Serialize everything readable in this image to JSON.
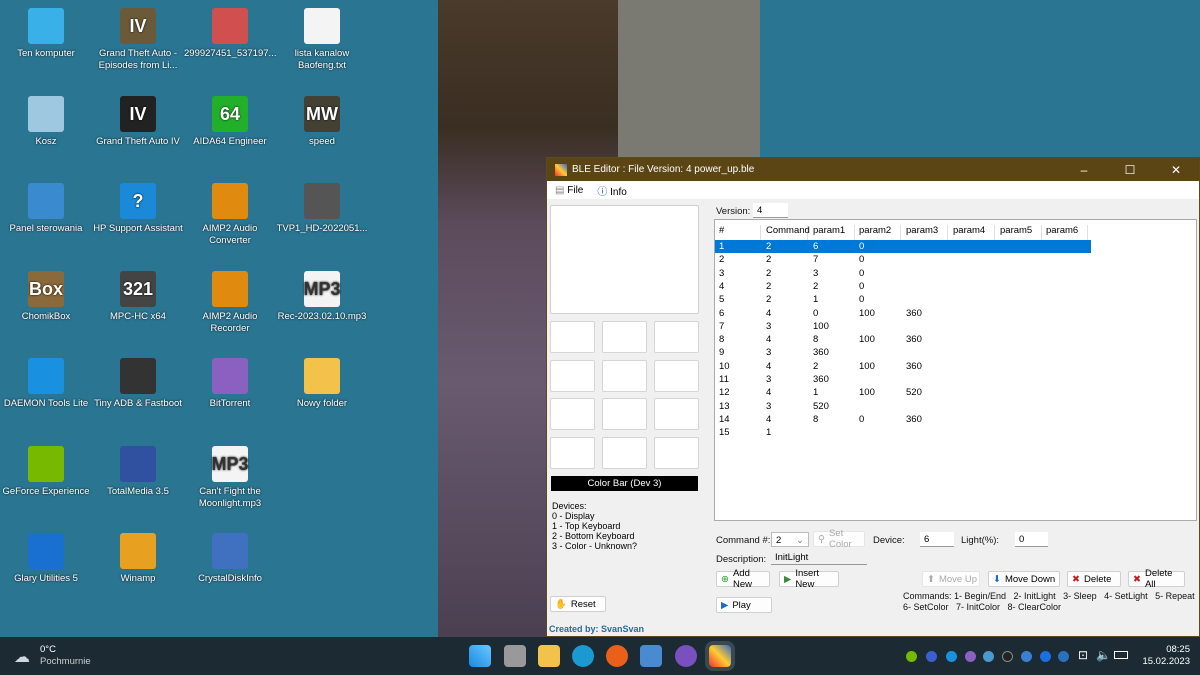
{
  "desktop": {
    "icons": [
      {
        "label": "Ten komputer",
        "color": "#3ab0e8",
        "glyph": "monitor-icon"
      },
      {
        "label": "Grand Theft Auto - Episodes from Li...",
        "color": "#6b5a3a",
        "glyph": "IV"
      },
      {
        "label": "299927451_537197...",
        "color": "#d05050",
        "glyph": "image-icon"
      },
      {
        "label": "lista kanalow Baofeng.txt",
        "color": "#f4f4f4",
        "glyph": "text-file-icon"
      },
      {
        "label": "Kosz",
        "color": "#9ec8e0",
        "glyph": "recycle-bin-icon"
      },
      {
        "label": "Grand Theft Auto IV",
        "color": "#222222",
        "glyph": "IV"
      },
      {
        "label": "AIDA64 Engineer",
        "color": "#22b02a",
        "glyph": "64"
      },
      {
        "label": "speed",
        "color": "#444033",
        "glyph": "MW"
      },
      {
        "label": "Panel sterowania",
        "color": "#3a8ad0",
        "glyph": "control-panel-icon"
      },
      {
        "label": "HP Support Assistant",
        "color": "#1a8ad8",
        "glyph": "?"
      },
      {
        "label": "AIMP2 Audio Converter",
        "color": "#e08a10",
        "glyph": "aimp-icon"
      },
      {
        "label": "TVP1_HD-2022051...",
        "color": "#555555",
        "glyph": "video-icon"
      },
      {
        "label": "ChomikBox",
        "color": "#8a6a3a",
        "glyph": "Box"
      },
      {
        "label": "MPC-HC x64",
        "color": "#444444",
        "glyph": "321"
      },
      {
        "label": "AIMP2 Audio Recorder",
        "color": "#e08a10",
        "glyph": "aimp-icon"
      },
      {
        "label": "Rec-2023.02.10.mp3",
        "color": "#f4f4f4",
        "glyph": "MP3"
      },
      {
        "label": "DAEMON Tools Lite",
        "color": "#1a90e0",
        "glyph": "daemon-icon"
      },
      {
        "label": "Tiny ADB & Fastboot",
        "color": "#333333",
        "glyph": "adb-icon"
      },
      {
        "label": "BitTorrent",
        "color": "#8a60c0",
        "glyph": "bittorrent-icon"
      },
      {
        "label": "Nowy folder",
        "color": "#f2c24a",
        "glyph": "folder-icon"
      },
      {
        "label": "GeForce Experience",
        "color": "#76b900",
        "glyph": "nvidia-icon"
      },
      {
        "label": "TotalMedia 3.5",
        "color": "#3050a0",
        "glyph": "totalmedia-icon"
      },
      {
        "label": "Can't Fight the Moonlight.mp3",
        "color": "#f4f4f4",
        "glyph": "MP3"
      },
      {
        "label": "",
        "color": "",
        "glyph": ""
      },
      {
        "label": "Glary Utilities 5",
        "color": "#1a70d0",
        "glyph": "glary-icon"
      },
      {
        "label": "Winamp",
        "color": "#e8a020",
        "glyph": "winamp-icon"
      },
      {
        "label": "CrystalDiskInfo",
        "color": "#4070c0",
        "glyph": "crystaldisk-icon"
      }
    ]
  },
  "window": {
    "title": "BLE Editor : File Version: 4  power_up.ble",
    "minimize": "–",
    "maximize": "☐",
    "close": "✕",
    "menu": {
      "file": "File",
      "info": "Info"
    },
    "version_label": "Version:",
    "version_value": "4",
    "color_bar": "Color Bar (Dev 3)",
    "devices_text": [
      "Devices:",
      "0 - Display",
      "1 - Top Keyboard",
      "2 - Bottom Keyboard",
      "3 - Color - Unknown?"
    ],
    "reset": "Reset",
    "created_by": "Created by: SvanSvan",
    "table": {
      "headers": [
        "#",
        "Command",
        "param1",
        "param2",
        "param3",
        "param4",
        "param5",
        "param6"
      ],
      "rows": [
        [
          "1",
          "2",
          "6",
          "0",
          "",
          "",
          "",
          ""
        ],
        [
          "2",
          "2",
          "7",
          "0",
          "",
          "",
          "",
          ""
        ],
        [
          "3",
          "2",
          "3",
          "0",
          "",
          "",
          "",
          ""
        ],
        [
          "4",
          "2",
          "2",
          "0",
          "",
          "",
          "",
          ""
        ],
        [
          "5",
          "2",
          "1",
          "0",
          "",
          "",
          "",
          ""
        ],
        [
          "6",
          "4",
          "0",
          "100",
          "360",
          "",
          "",
          ""
        ],
        [
          "7",
          "3",
          "100",
          "",
          "",
          "",
          "",
          ""
        ],
        [
          "8",
          "4",
          "8",
          "100",
          "360",
          "",
          "",
          ""
        ],
        [
          "9",
          "3",
          "360",
          "",
          "",
          "",
          "",
          ""
        ],
        [
          "10",
          "4",
          "2",
          "100",
          "360",
          "",
          "",
          ""
        ],
        [
          "11",
          "3",
          "360",
          "",
          "",
          "",
          "",
          ""
        ],
        [
          "12",
          "4",
          "1",
          "100",
          "520",
          "",
          "",
          ""
        ],
        [
          "13",
          "3",
          "520",
          "",
          "",
          "",
          "",
          ""
        ],
        [
          "14",
          "4",
          "8",
          "0",
          "360",
          "",
          "",
          ""
        ],
        [
          "15",
          "1",
          "",
          "",
          "",
          "",
          "",
          ""
        ]
      ],
      "selected_row": 0
    },
    "command_label": "Command #:",
    "command_value": "2",
    "set_color": "Set Color",
    "device_label": "Device:",
    "device_value": "6",
    "light_label": "Light(%):",
    "light_value": "0",
    "description_label": "Description:",
    "description_value": "InitLight",
    "add_new": "Add New",
    "insert_new": "Insert New",
    "play": "Play",
    "move_up": "Move Up",
    "move_down": "Move Down",
    "delete": "Delete",
    "delete_all": "Delete All",
    "commands_line1": "Commands: 1- Begin/End   2- InitLight   3- Sleep   4- SetLight   5- Repeat",
    "commands_line2": "6- SetColor   7- InitColor   8- ClearColor"
  },
  "taskbar": {
    "weather_temp": "0°C",
    "weather_desc": "Pochmurnie",
    "time": "08:25",
    "date": "15.02.2023"
  }
}
